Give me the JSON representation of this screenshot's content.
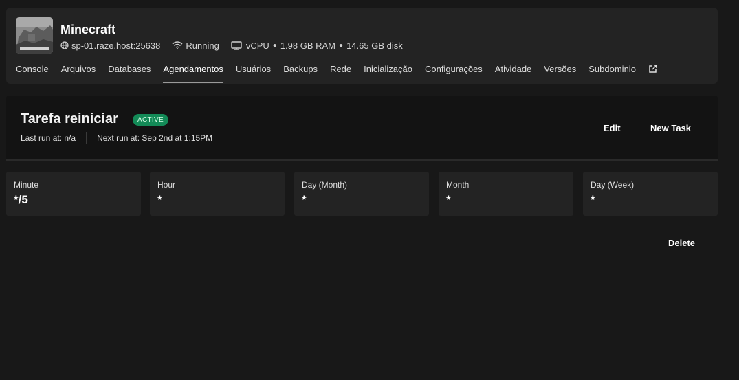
{
  "server": {
    "name": "Minecraft",
    "address": "sp-01.raze.host:25638",
    "status": "Running",
    "cpu": "vCPU",
    "ram": "1.98 GB RAM",
    "disk": "14.65 GB disk",
    "separator": "●"
  },
  "nav": {
    "tabs": [
      {
        "label": "Console"
      },
      {
        "label": "Arquivos"
      },
      {
        "label": "Databases"
      },
      {
        "label": "Agendamentos"
      },
      {
        "label": "Usuários"
      },
      {
        "label": "Backups"
      },
      {
        "label": "Rede"
      },
      {
        "label": "Inicialização"
      },
      {
        "label": "Configurações"
      },
      {
        "label": "Atividade"
      },
      {
        "label": "Versões"
      },
      {
        "label": "Subdominio"
      }
    ],
    "active": "Agendamentos",
    "external_icon": "external-link-icon"
  },
  "task": {
    "title": "Tarefa reiniciar",
    "badge": "ACTIVE",
    "last_run": "Last run at: n/a",
    "next_run": "Next run at: Sep 2nd at 1:15PM",
    "edit_label": "Edit",
    "new_task_label": "New Task"
  },
  "cron": [
    {
      "label": "Minute",
      "value": "*/5"
    },
    {
      "label": "Hour",
      "value": "*"
    },
    {
      "label": "Day (Month)",
      "value": "*"
    },
    {
      "label": "Month",
      "value": "*"
    },
    {
      "label": "Day (Week)",
      "value": "*"
    }
  ],
  "delete_label": "Delete",
  "colors": {
    "background": "#181818",
    "card": "#232323",
    "badge": "#138a57"
  }
}
